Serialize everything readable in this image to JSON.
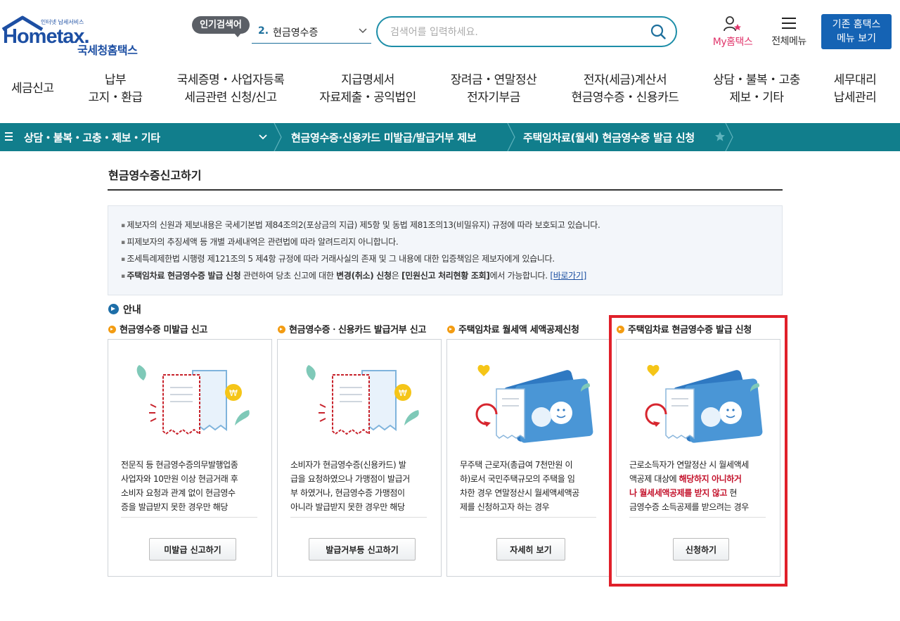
{
  "header": {
    "logo_word": "Hometax.",
    "logo_tag": "인터넷 납세서비스",
    "logo_kr": "국세청홈택스",
    "popular_badge": "인기검색어",
    "popular_num": "2.",
    "popular_term": "현금영수증",
    "search_placeholder": "검색어를 입력하세요.",
    "my_hometax": "My홈택스",
    "all_menu": "전체메뉴",
    "old_menu_line1": "기존 홈택스",
    "old_menu_line2": "메뉴 보기"
  },
  "gnb": [
    {
      "l1": "세금신고",
      "l2": ""
    },
    {
      "l1": "납부",
      "l2": "고지・환급"
    },
    {
      "l1": "국세증명・사업자등록",
      "l2": "세금관련 신청/신고"
    },
    {
      "l1": "지급명세서",
      "l2": "자료제출・공익법인"
    },
    {
      "l1": "장려금・연말정산",
      "l2": "전자기부금"
    },
    {
      "l1": "전자(세금)계산서",
      "l2": "현금영수증・신용카드"
    },
    {
      "l1": "상담・불복・고충",
      "l2": "제보・기타"
    },
    {
      "l1": "세무대리",
      "l2": "납세관리"
    }
  ],
  "breadcrumb": {
    "level1": "상담・불복・고충・제보・기타",
    "level2": "현금영수증·신용카드 미발급/발급거부 제보",
    "level3": "주택임차료(월세) 현금영수증 발급 신청"
  },
  "page_title": "현금영수증신고하기",
  "notice": {
    "line1": "제보자의 신원과 제보내용은 국세기본법 제84조의2(포상금의 지급) 제5항 및 동법 제81조의13(비밀유지) 규정에 따라 보호되고 있습니다.",
    "line2": "피제보자의 추징세액 등 개별 과세내역은 관련법에 따라 알려드리지 아니합니다.",
    "line3": "조세특례제한법 시행령 제121조의 5 제4항 규정에 따라 거래사실의 존재 및 그 내용에 대한 입증책임은 제보자에게 있습니다.",
    "line4_b1": "주택임차료 현금영수증 발급 신청",
    "line4_t1": " 관련하여 당초 신고에 대한 ",
    "line4_b2": "변경(취소) 신청",
    "line4_t2": "은 ",
    "line4_b3": "[민원신고 처리현황 조회]",
    "line4_t3": "에서 가능합니다. ",
    "line4_link": "[바로가기]"
  },
  "guide_title": "안내",
  "cards": [
    {
      "heading": "현금영수증 미발급 신고",
      "desc": [
        "전문직 등 현금영수증의무발행업종",
        "사업자와 10만원 이상 현금거래 후",
        "소비자 요청과 관계 없이 현금영수",
        "증을 발급받지 못한 경우만 해당"
      ],
      "button": "미발급 신고하기"
    },
    {
      "heading": "현금영수증ㆍ신용카드 발급거부 신고",
      "desc": [
        "소비자가 현금영수증(신용카드) 발",
        "급을 요청하였으나 가맹점이 발급거",
        "부 하였거나, 현금영수증 가맹점이",
        "아니라 발급받지 못한 경우만 해당"
      ],
      "button": "발급거부등 신고하기"
    },
    {
      "heading": "주택임차료 월세액 세액공제신청",
      "desc": [
        "무주택 근로자(총급여 7천만원 이",
        "하)로서 국민주택규모의 주택을 임",
        "차한 경우 연말정산시 월세액세액공",
        "제를 신청하고자 하는 경우"
      ],
      "button": "자세히 보기"
    },
    {
      "heading": "주택임차료 현금영수증 발급 신청",
      "desc_a": "근로소득자가 연말정산 시 월세액세",
      "desc_b": "액공제 대상에 ",
      "desc_hl1": "해당하지 아니하거",
      "desc_hl2": "나 월세세액공제를 받지 않고",
      "desc_c": " 현",
      "desc_d": "금영수증 소득공제를 받으려는 경우",
      "button": "신청하기"
    }
  ],
  "colors": {
    "brand_blue": "#1d4fa3",
    "teal_bar": "#117e8c",
    "highlight_red": "#e0202a",
    "emphasis_red": "#c4142d"
  }
}
